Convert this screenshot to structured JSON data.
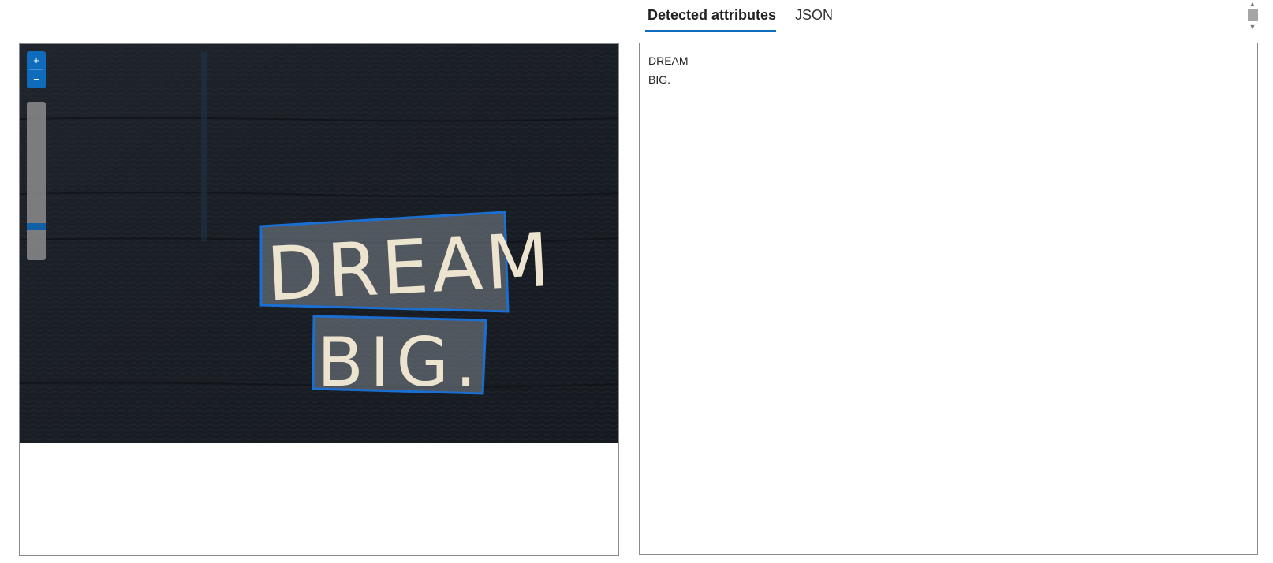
{
  "viewer": {
    "zoom_in_symbol": "+",
    "zoom_out_symbol": "−",
    "zoom_level_fraction": 0.06,
    "image_text": [
      "DREAM",
      "BIG."
    ],
    "highlight_color": "#1b6fd1"
  },
  "tabs": [
    {
      "label": "Detected attributes",
      "active": true
    },
    {
      "label": "JSON",
      "active": false
    }
  ],
  "results": {
    "lines": [
      "DREAM",
      "BIG."
    ]
  },
  "scrollbar": {
    "up_symbol": "▲",
    "down_symbol": "▼"
  },
  "colors": {
    "accent": "#0f6cbd",
    "border": "#8a8a8a",
    "image_background": "#1d2026"
  }
}
